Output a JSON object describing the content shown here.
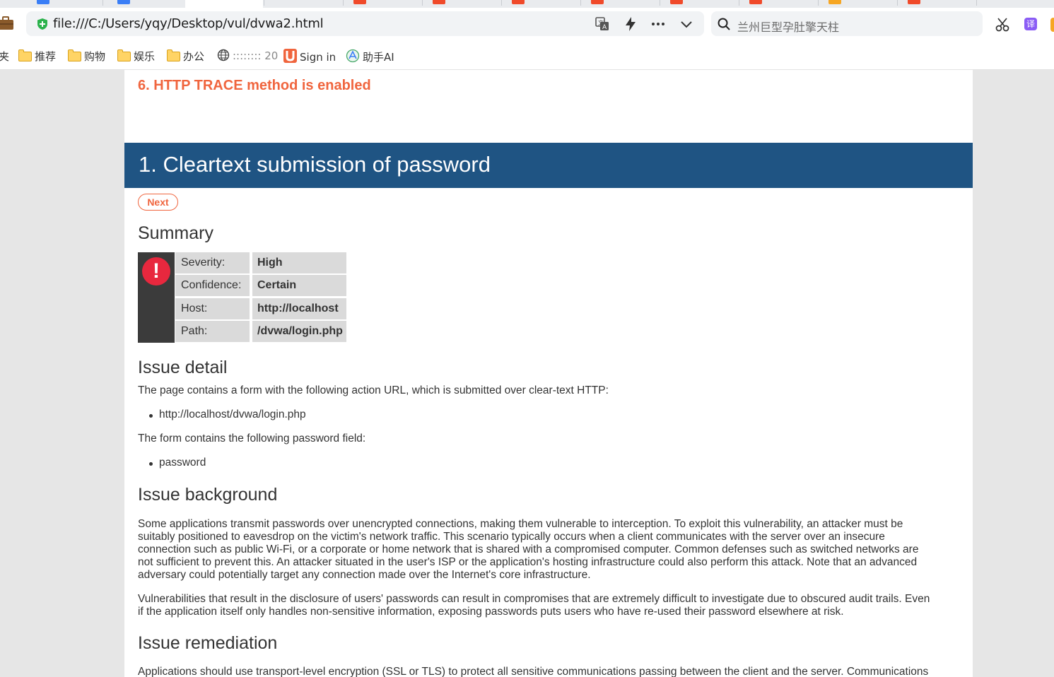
{
  "browser": {
    "url": "file:///C:/Users/yqy/Desktop/vul/dvwa2.html",
    "search_placeholder": "兰州巨型孕肚擎天柱",
    "translate_label": "译",
    "bookmarks": [
      {
        "label": "夹",
        "icon": "folder-partial"
      },
      {
        "label": "推荐",
        "icon": "folder-icon"
      },
      {
        "label": "购物",
        "icon": "folder-icon"
      },
      {
        "label": "娱乐",
        "icon": "folder-icon"
      },
      {
        "label": "办公",
        "icon": "folder-icon"
      },
      {
        "label": ":::::::: 20",
        "icon": "globe-icon"
      },
      {
        "label": "Sign in",
        "icon": "u-logo-icon"
      },
      {
        "label": "助手AI",
        "icon": "assistant-icon"
      }
    ],
    "colors": {
      "tab_red": "#f04a2a",
      "tab_blue": "#3a7ef6",
      "secure_green": "#2bb24c"
    }
  },
  "report": {
    "previous_issue": "6. HTTP TRACE method is enabled",
    "issue_title": "1. Cleartext submission of password",
    "next_label": "Next",
    "summary_heading": "Summary",
    "summary": [
      {
        "label": "Severity:",
        "value": "High"
      },
      {
        "label": "Confidence:",
        "value": "Certain"
      },
      {
        "label": "Host:",
        "value": "http://localhost"
      },
      {
        "label": "Path:",
        "value": "/dvwa/login.php"
      }
    ],
    "detail_heading": "Issue detail",
    "detail_text_1": "The page contains a form with the following action URL, which is submitted over clear-text HTTP:",
    "detail_bullet_1": "http://localhost/dvwa/login.php",
    "detail_text_2": "The form contains the following password field:",
    "detail_bullet_2": "password",
    "background_heading": "Issue background",
    "background_p1": [
      "Some applications transmit passwords over unencrypted connections, making them vulnerable to interception. To exploit this vulnerability, an attacker must be",
      "suitably positioned to eavesdrop on the victim's network traffic. This scenario typically occurs when a client communicates with the server over an insecure",
      "connection such as public Wi-Fi, or a corporate or home network that is shared with a compromised computer. Common defenses such as switched networks are",
      "not sufficient to prevent this. An attacker situated in the user's ISP or the application's hosting infrastructure could also perform this attack. Note that an advanced",
      "adversary could potentially target any connection made over the Internet's core infrastructure."
    ],
    "background_p2": [
      "Vulnerabilities that result in the disclosure of users' passwords can result in compromises that are extremely difficult to investigate due to obscured audit trails. Even",
      "if the application itself only handles non-sensitive information, exposing passwords puts users who have re-used their password elsewhere at risk."
    ],
    "remediation_heading": "Issue remediation",
    "remediation_p1": "Applications should use transport-level encryption (SSL or TLS) to protect all sensitive communications passing between the client and the server. Communications",
    "colors": {
      "banner": "#1f5483",
      "accent_orange": "#f0653e",
      "severity_red": "#e8283e"
    }
  }
}
